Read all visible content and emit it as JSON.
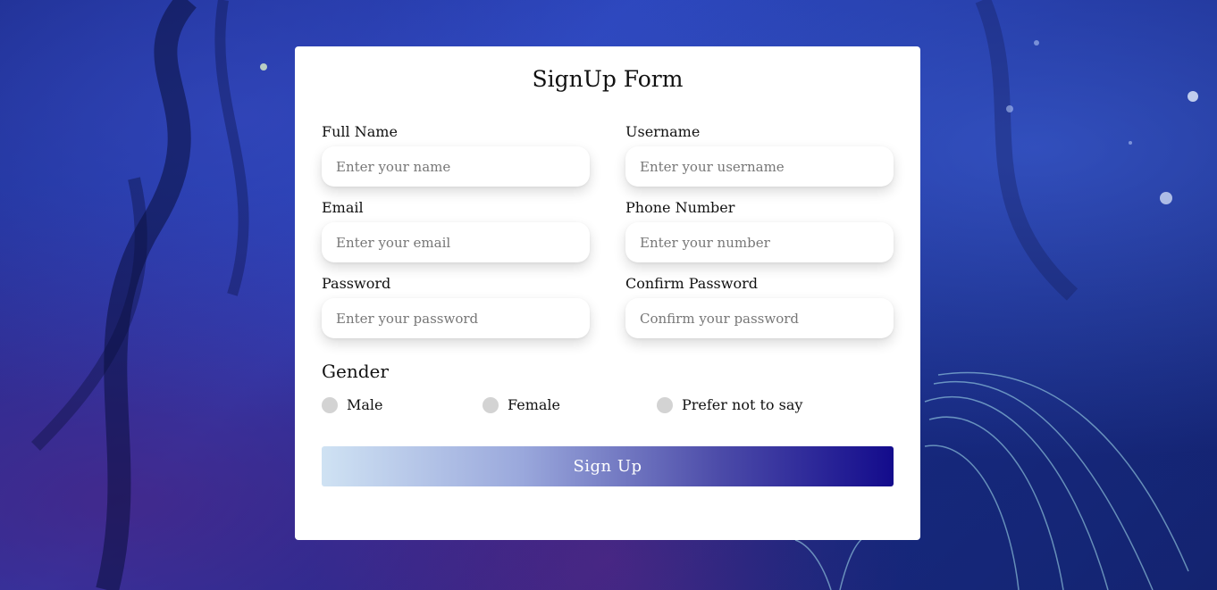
{
  "form": {
    "title": "SignUp Form",
    "fields": {
      "full_name": {
        "label": "Full Name",
        "placeholder": "Enter your name",
        "value": ""
      },
      "username": {
        "label": "Username",
        "placeholder": "Enter your username",
        "value": ""
      },
      "email": {
        "label": "Email",
        "placeholder": "Enter your email",
        "value": ""
      },
      "phone": {
        "label": "Phone Number",
        "placeholder": "Enter your number",
        "value": ""
      },
      "password": {
        "label": "Password",
        "placeholder": "Enter your password",
        "value": ""
      },
      "confirm_password": {
        "label": "Confirm Password",
        "placeholder": "Confirm your password",
        "value": ""
      }
    },
    "gender": {
      "title": "Gender",
      "options": [
        "Male",
        "Female",
        "Prefer not to say"
      ]
    },
    "submit_label": "Sign Up"
  },
  "colors": {
    "radio_unselected": "#d3d3d3",
    "button_gradient_start": "#cfe2f3",
    "button_gradient_end": "#130b8c",
    "card_background": "#ffffff"
  }
}
